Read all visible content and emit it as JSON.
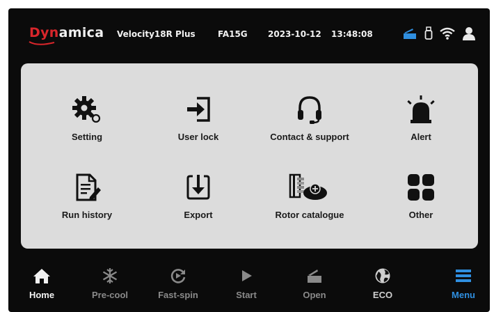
{
  "status": {
    "brand_prefix": "Dyn",
    "brand_suffix": "amica",
    "model": "Velocity18R Plus",
    "rotor": "FA15G",
    "date": "2023-10-12",
    "time": "13:48:08",
    "icons": [
      "lid-icon",
      "usb-drive-icon",
      "wifi-icon",
      "user-icon"
    ]
  },
  "menu": {
    "tiles": [
      {
        "label": "Setting",
        "icon": "gear-icon"
      },
      {
        "label": "User lock",
        "icon": "login-icon"
      },
      {
        "label": "Contact & support",
        "icon": "headset-icon"
      },
      {
        "label": "Alert",
        "icon": "alarm-light-icon"
      },
      {
        "label": "Run history",
        "icon": "document-edit-icon"
      },
      {
        "label": "Export",
        "icon": "export-icon"
      },
      {
        "label": "Rotor catalogue",
        "icon": "rotor-catalogue-icon"
      },
      {
        "label": "Other",
        "icon": "grid-icon"
      }
    ]
  },
  "nav": {
    "items": [
      {
        "label": "Home",
        "icon": "home-icon",
        "state": "active-white"
      },
      {
        "label": "Pre-cool",
        "icon": "snowflake-icon",
        "state": "disabled"
      },
      {
        "label": "Fast-spin",
        "icon": "fast-spin-icon",
        "state": "disabled"
      },
      {
        "label": "Start",
        "icon": "play-icon",
        "state": "disabled"
      },
      {
        "label": "Open",
        "icon": "lid-open-icon",
        "state": "disabled"
      },
      {
        "label": "ECO",
        "icon": "eco-icon",
        "state": "normal"
      },
      {
        "label": "Menu",
        "icon": "menu-icon",
        "state": "selected"
      }
    ]
  },
  "colors": {
    "brand_red": "#d9262b",
    "accent_blue": "#2f8fe0",
    "panel_gray": "#dcdcdc",
    "background": "#0b0b0b",
    "disabled_gray": "#8a8a8a"
  }
}
